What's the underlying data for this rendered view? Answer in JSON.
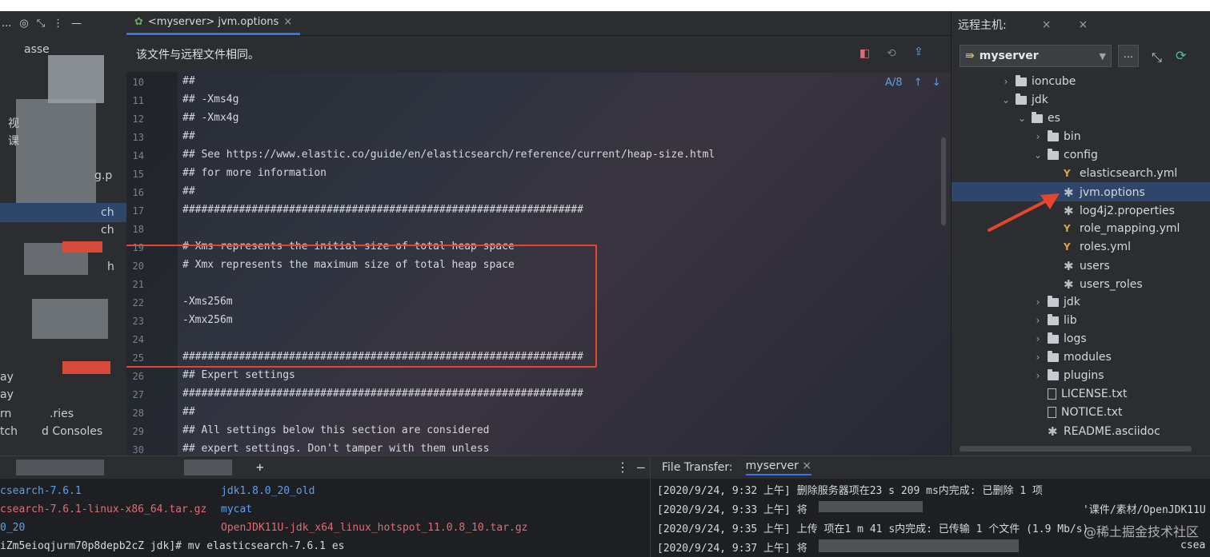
{
  "left": {
    "rows": [
      "asse",
      "视",
      "课",
      "g.p",
      "ch",
      "ch",
      "h",
      "ay",
      "ay",
      "rn",
      ".ries",
      "tch",
      "d Consoles"
    ]
  },
  "editor": {
    "tab_label": "<myserver> jvm.options",
    "banner": "该文件与远程文件相同。",
    "search_count": "8",
    "lines": [
      {
        "n": "10",
        "t": "##"
      },
      {
        "n": "11",
        "t": "## -Xms4g"
      },
      {
        "n": "12",
        "t": "## -Xmx4g"
      },
      {
        "n": "13",
        "t": "##"
      },
      {
        "n": "14",
        "t": "## See https://www.elastic.co/guide/en/elasticsearch/reference/current/heap-size.html"
      },
      {
        "n": "15",
        "t": "## for more information"
      },
      {
        "n": "16",
        "t": "##"
      },
      {
        "n": "17",
        "t": "################################################################"
      },
      {
        "n": "18",
        "t": ""
      },
      {
        "n": "19",
        "t": "# Xms represents the initial size of total heap space"
      },
      {
        "n": "20",
        "t": "# Xmx represents the maximum size of total heap space"
      },
      {
        "n": "21",
        "t": ""
      },
      {
        "n": "22",
        "t": "-Xms256m"
      },
      {
        "n": "23",
        "t": "-Xmx256m"
      },
      {
        "n": "24",
        "t": ""
      },
      {
        "n": "25",
        "t": "################################################################"
      },
      {
        "n": "26",
        "t": "## Expert settings"
      },
      {
        "n": "27",
        "t": "################################################################"
      },
      {
        "n": "28",
        "t": "##"
      },
      {
        "n": "29",
        "t": "## All settings below this section are considered"
      },
      {
        "n": "30",
        "t": "## expert settings. Don't tamper with them unless"
      }
    ]
  },
  "remote": {
    "title": "远程主机:",
    "host": "myserver",
    "more": "...",
    "tree": [
      {
        "label": "ioncube",
        "kind": "folder",
        "level": 0,
        "open": false
      },
      {
        "label": "jdk",
        "kind": "folder",
        "level": 0,
        "open": true
      },
      {
        "label": "es",
        "kind": "folder",
        "level": 1,
        "open": true
      },
      {
        "label": "bin",
        "kind": "folder",
        "level": 2,
        "open": false
      },
      {
        "label": "config",
        "kind": "folder",
        "level": 2,
        "open": true
      },
      {
        "label": "elasticsearch.yml",
        "kind": "yml",
        "level": 3
      },
      {
        "label": "jvm.options",
        "kind": "star",
        "level": 3
      },
      {
        "label": "log4j2.properties",
        "kind": "star",
        "level": 3
      },
      {
        "label": "role_mapping.yml",
        "kind": "yml",
        "level": 3
      },
      {
        "label": "roles.yml",
        "kind": "yml",
        "level": 3
      },
      {
        "label": "users",
        "kind": "star",
        "level": 3
      },
      {
        "label": "users_roles",
        "kind": "star",
        "level": 3
      },
      {
        "label": "jdk",
        "kind": "folder",
        "level": 2,
        "open": false
      },
      {
        "label": "lib",
        "kind": "folder",
        "level": 2,
        "open": false
      },
      {
        "label": "logs",
        "kind": "folder",
        "level": 2,
        "open": false
      },
      {
        "label": "modules",
        "kind": "folder",
        "level": 2,
        "open": false
      },
      {
        "label": "plugins",
        "kind": "folder",
        "level": 2,
        "open": false
      },
      {
        "label": "LICENSE.txt",
        "kind": "file",
        "level": 2
      },
      {
        "label": "NOTICE.txt",
        "kind": "file",
        "level": 2
      },
      {
        "label": "README.asciidoc",
        "kind": "star",
        "level": 2
      }
    ]
  },
  "terminal": {
    "add_label": "+",
    "left_col": [
      "csearch-7.6.1",
      "csearch-7.6.1-linux-x86_64.tar.gz",
      "0_20"
    ],
    "right_col": [
      "jdk1.8.0_20_old",
      "mycat",
      "OpenJDK11U-jdk_x64_linux_hotspot_11.0.8_10.tar.gz"
    ],
    "prompt": "iZm5eioqjurm70p8depb2cZ jdk]# mv elasticsearch-7.6.1 es"
  },
  "transfer": {
    "title": "File Transfer:",
    "tab": "myserver",
    "lines": [
      "[2020/9/24, 9:32 上午] 删除服务器项在23 s 209 ms内完成: 已删除 1 项",
      "[2020/9/24, 9:33 上午] 将",
      "[2020/9/24, 9:35 上午] 上传 项在1 m 41 s内完成: 已传输 1 个文件 (1.9 Mb/s)",
      "[2020/9/24, 9:37 上午] 将"
    ],
    "path_fragment": "'课件/素材/OpenJDK11U",
    "tail_fragment": "csea"
  },
  "watermark": "@稀土掘金技术社区",
  "colors": {
    "accent": "#3574f0",
    "highlight": "#e4462d",
    "selection": "#2d4669"
  }
}
